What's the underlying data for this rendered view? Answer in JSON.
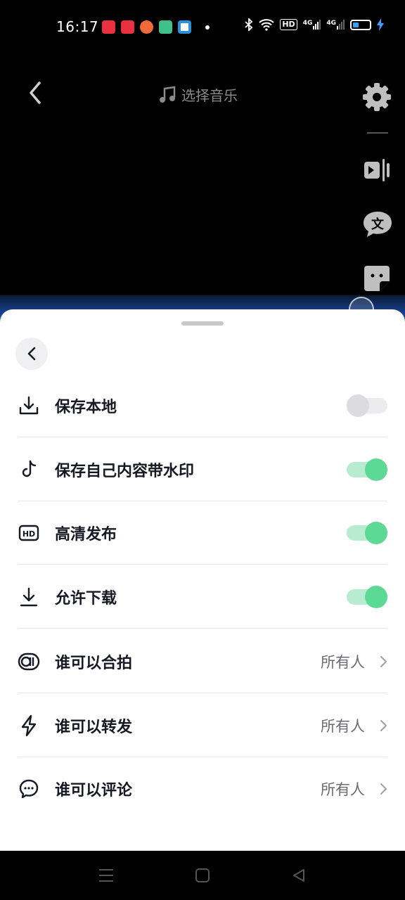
{
  "status_bar": {
    "time": "16:17",
    "app_icon_colors": [
      "#e8313e",
      "#e8313e",
      "#f06a3a",
      "#3fbf8a",
      "#2b8fe0"
    ],
    "hd_label": "HD",
    "signal1": "4G",
    "signal2": "4G"
  },
  "camera": {
    "music_label": "选择音乐"
  },
  "sheet": {
    "rows": [
      {
        "label": "保存本地",
        "icon": "download-tray-icon",
        "toggle": "off"
      },
      {
        "label": "保存自己内容带水印",
        "icon": "tiktok-note-icon",
        "toggle": "on"
      },
      {
        "label": "高清发布",
        "icon": "hd-icon",
        "toggle": "on"
      },
      {
        "label": "允许下载",
        "icon": "download-icon",
        "toggle": "on"
      },
      {
        "label": "谁可以合拍",
        "icon": "duet-icon",
        "value": "所有人"
      },
      {
        "label": "谁可以转发",
        "icon": "lightning-icon",
        "value": "所有人"
      },
      {
        "label": "谁可以评论",
        "icon": "comment-icon",
        "value": "所有人"
      }
    ]
  },
  "colors": {
    "toggle_on": "#5cd994",
    "toggle_off": "#dcdcde",
    "sheet_bg": "#ffffff"
  }
}
